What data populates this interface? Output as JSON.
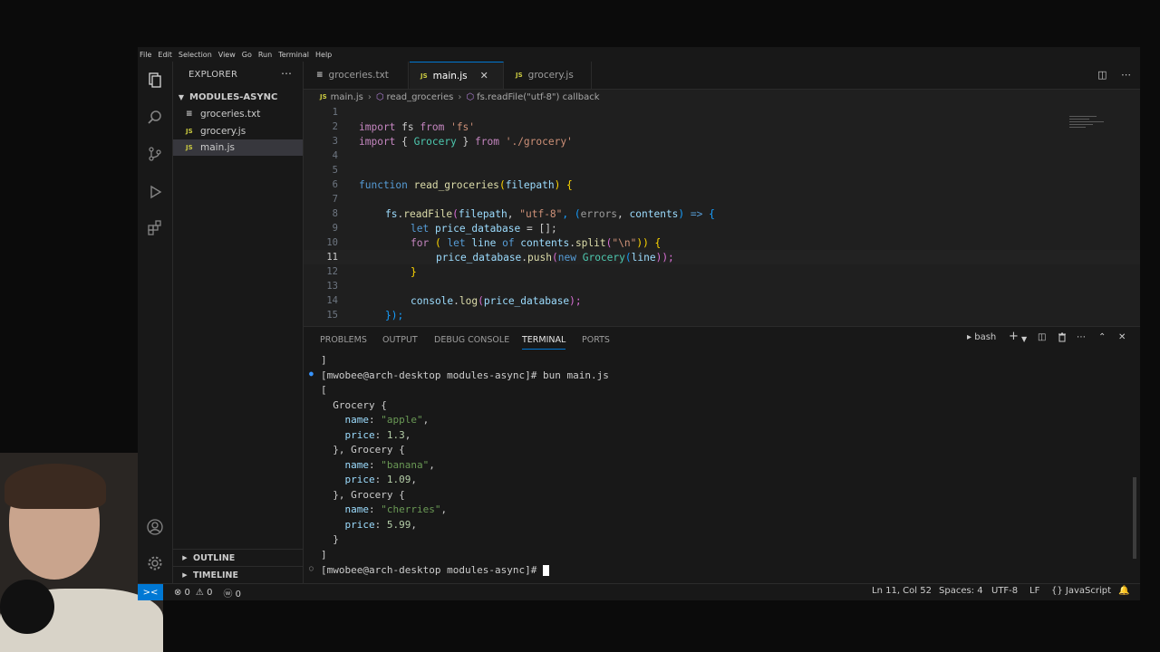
{
  "menu": [
    "File",
    "Edit",
    "Selection",
    "View",
    "Go",
    "Run",
    "Terminal",
    "Help"
  ],
  "explorer": {
    "title": "EXPLORER",
    "more": "⋯",
    "folder": "MODULES-ASYNC",
    "files": [
      {
        "icon": "≡",
        "name": "groceries.txt"
      },
      {
        "icon": "JS",
        "name": "grocery.js"
      },
      {
        "icon": "JS",
        "name": "main.js"
      }
    ],
    "outline": "OUTLINE",
    "timeline": "TIMELINE"
  },
  "tabs": [
    {
      "icon": "≡",
      "name": "groceries.txt"
    },
    {
      "icon": "JS",
      "name": "main.js",
      "close": "✕"
    },
    {
      "icon": "JS",
      "name": "grocery.js"
    }
  ],
  "breadcrumb": {
    "file_icon": "JS",
    "file": "main.js",
    "sep": "›",
    "fn1_icon": "⬡",
    "fn1": "read_groceries",
    "fn2_icon": "⬡",
    "fn2": "fs.readFile(\"utf-8\") callback"
  },
  "code": {
    "line_numbers": [
      "1",
      "2",
      "3",
      "4",
      "5",
      "6",
      "7",
      "8",
      "9",
      "10",
      "11",
      "12",
      "13",
      "14",
      "15"
    ],
    "l2": {
      "kw": "import",
      "a": " fs ",
      "b": "from",
      "c": " ",
      "s": "'fs'"
    },
    "l3": {
      "kw": "import",
      "a": " { ",
      "cls": "Grocery",
      "b": " } ",
      "c": "from",
      "d": " ",
      "s": "'./grocery'"
    },
    "l6": {
      "kw": "function",
      "fn": " read_groceries",
      "p": "(",
      "arg": "filepath",
      "p2": ") {"
    },
    "l8": {
      "a": "fs",
      "b": ".",
      "fn": "readFile",
      "c": "(",
      "arg": "filepath",
      "d": ", ",
      "s": "\"utf-8\"",
      "e": ", (",
      "p1": "errors",
      "f": ", ",
      "p2": "contents",
      "g": ") ",
      "arrow": "=>",
      "h": " {"
    },
    "l9": {
      "kw": "let",
      "v": " price_database",
      "rest": " = [];"
    },
    "l10": {
      "kw": "for",
      "a": " ( ",
      "kw2": "let",
      "v": " line ",
      "kw3": "of",
      "v2": " contents",
      "b": ".",
      "fn": "split",
      "c": "(",
      "s": "\"\\n\"",
      "d": ")) {"
    },
    "l11": {
      "v": "price_database",
      "a": ".",
      "fn": "push",
      "b": "(",
      "kw": "new",
      "c": " ",
      "cls": "Grocery",
      "d": "(",
      "v2": "line",
      "e": "));"
    },
    "l12": "}",
    "l14": {
      "v": "console",
      "a": ".",
      "fn": "log",
      "b": "(",
      "v2": "price_database",
      "c": ");"
    },
    "l15": "});"
  },
  "panel": {
    "tabs": [
      "PROBLEMS",
      "OUTPUT",
      "DEBUG CONSOLE",
      "TERMINAL",
      "PORTS"
    ],
    "shell": "bash",
    "add": "+",
    "split_icon": "◫",
    "trash_icon": "🗑",
    "more": "⋯",
    "maximize": "⌃",
    "close": "✕"
  },
  "terminal": {
    "l0": "]",
    "prompt": "[mwobee@arch-desktop modules-async]# ",
    "command": "bun main.js",
    "lines": [
      {
        "t": "["
      },
      {
        "t": "  Grocery {"
      },
      {
        "k": "    name",
        "s": "\"apple\""
      },
      {
        "k": "    price",
        "n": "1.3"
      },
      {
        "t": "  }, Grocery {"
      },
      {
        "k": "    name",
        "s": "\"banana\""
      },
      {
        "k": "    price",
        "n": "1.09"
      },
      {
        "t": "  }, Grocery {"
      },
      {
        "k": "    name",
        "s": "\"cherries\""
      },
      {
        "k": "    price",
        "n": "5.99"
      },
      {
        "t": "  }"
      },
      {
        "t": "]"
      }
    ],
    "prompt2": "[mwobee@arch-desktop modules-async]# "
  },
  "status": {
    "remote": "><",
    "errors": "⊗ 0",
    "warnings": "⚠ 0",
    "ports": "ⓦ 0",
    "position": "Ln 11, Col 52",
    "spaces": "Spaces: 4",
    "encoding": "UTF-8",
    "eol": "LF",
    "language": "{} JavaScript",
    "bell": "🔔"
  },
  "colors": {
    "accent": "#0078d4",
    "js_icon": "#cbcb41"
  }
}
